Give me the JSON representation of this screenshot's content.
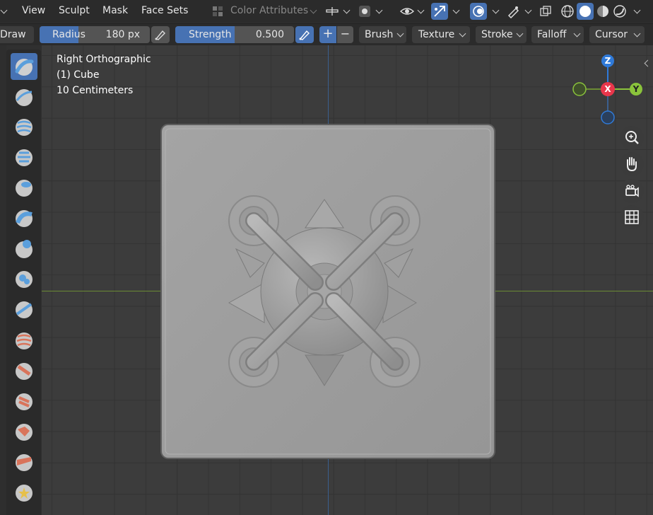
{
  "menu": {
    "view": "View",
    "sculpt": "Sculpt",
    "mask": "Mask",
    "face_sets": "Face Sets",
    "color_attributes": "Color Attributes"
  },
  "tool_header": {
    "brush_name": "Draw",
    "radius_label": "Radius",
    "radius_value": "180 px",
    "strength_label": "Strength",
    "strength_value": "0.500",
    "plus": "+",
    "minus": "−",
    "dropdowns": [
      "Brush",
      "Texture",
      "Stroke",
      "Falloff",
      "Cursor"
    ]
  },
  "viewport_info": {
    "view_name": "Right Orthographic",
    "object": "(1) Cube",
    "scale": "10 Centimeters"
  },
  "gizmo": {
    "z": "Z",
    "x": "X",
    "y": "Y",
    "colors": {
      "z": "#2f7ad9",
      "x": "#e8364b",
      "y": "#8ac33b"
    }
  },
  "toolbar": {
    "active_tool": "draw-brush",
    "tools": [
      "draw",
      "draw-sharp",
      "clay",
      "clay-strips",
      "clay-thumb",
      "layer",
      "inflate",
      "blob",
      "crease",
      "smooth",
      "flatten",
      "fill",
      "scrape",
      "multiplane-scrape",
      "pinch"
    ]
  },
  "colors": {
    "accent": "#4772b3",
    "header_bg": "#2b2b2b",
    "viewport_bg": "#3c3c3c"
  }
}
